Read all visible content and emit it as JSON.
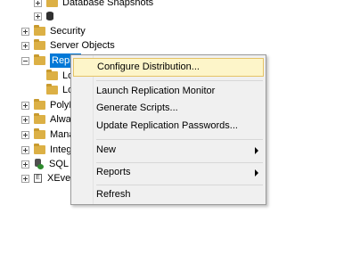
{
  "tree": {
    "snapshots": "Database Snapshots",
    "security": "Security",
    "server_objects": "Server Objects",
    "replication": "Replic",
    "local_publications": "Lo",
    "local_subscriptions": "Lo",
    "polybase": "PolyB",
    "always_on": "Alway",
    "management": "Mana",
    "integration": "Integr",
    "sql_agent": "SQL S",
    "xevent": "XEven"
  },
  "context_menu": {
    "configure_distribution": "Configure Distribution...",
    "launch_monitor": "Launch Replication Monitor",
    "generate_scripts": "Generate Scripts...",
    "update_passwords": "Update Replication Passwords...",
    "new": "New",
    "reports": "Reports",
    "refresh": "Refresh"
  },
  "icons": {
    "folder": "folder-icon",
    "database": "database-icon",
    "agent": "sql-agent-icon",
    "xevent": "xevent-icon",
    "expand": "plus-icon",
    "collapse": "minus-icon",
    "submenu": "chevron-right-icon"
  },
  "colors": {
    "selection": "#0078d7",
    "menu_highlight": "#fdf5c9",
    "menu_highlight_border": "#e5c365",
    "folder": "#dcb045"
  }
}
